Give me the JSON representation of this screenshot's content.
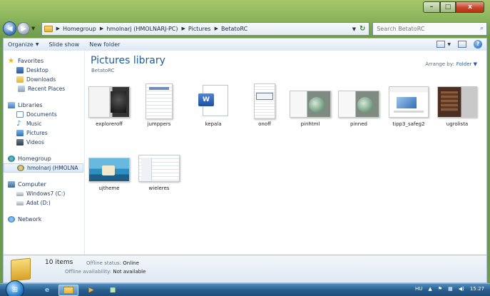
{
  "window": {
    "caption": {
      "minimize": "–",
      "maximize": "□",
      "close": "x"
    }
  },
  "nav": {
    "back": "◀",
    "forward": "▶",
    "recent": "▼",
    "breadcrumbs": [
      "Homegroup",
      "hmolnarj (HMOLNARJ-PC)",
      "Pictures",
      "BetatoRC"
    ],
    "refresh": "↻",
    "search_placeholder": "Search BetatoRC",
    "search_icon": "⌕"
  },
  "toolbar": {
    "organize": "Organize",
    "slideshow": "Slide show",
    "new_folder": "New folder",
    "help": "?"
  },
  "sidebar": {
    "favorites": {
      "label": "Favorites",
      "items": [
        "Desktop",
        "Downloads",
        "Recent Places"
      ]
    },
    "libraries": {
      "label": "Libraries",
      "items": [
        "Documents",
        "Music",
        "Pictures",
        "Videos"
      ]
    },
    "homegroup": {
      "label": "Homegroup",
      "items": [
        "hmolnarj (HMOLNA"
      ]
    },
    "computer": {
      "label": "Computer",
      "items": [
        "Windows7 (C:)",
        "Adat (D:)"
      ]
    },
    "network": {
      "label": "Network"
    }
  },
  "library": {
    "title": "Pictures library",
    "subtitle": "BetatoRC",
    "arrange_label": "Arrange by:",
    "arrange_value": "Folder"
  },
  "files": [
    {
      "name": "exploreroff",
      "art": "explorer"
    },
    {
      "name": "jumppers",
      "art": "doc"
    },
    {
      "name": "kepala",
      "art": "word"
    },
    {
      "name": "onoff",
      "art": "onoff"
    },
    {
      "name": "pinhtml",
      "art": "pin"
    },
    {
      "name": "pinned",
      "art": "pin"
    },
    {
      "name": "tipp3_safeg2",
      "art": "tipp"
    },
    {
      "name": "ugrolista",
      "art": "ugro"
    },
    {
      "name": "ujtheme",
      "art": "uj"
    },
    {
      "name": "wieleres",
      "art": "wie"
    }
  ],
  "details": {
    "count": "10 items",
    "status_label": "Offline status:",
    "status_value": "Online",
    "availability_label": "Offline availability:",
    "availability_value": "Not available"
  },
  "taskbar": {
    "language": "HU",
    "clock": "15:27"
  }
}
